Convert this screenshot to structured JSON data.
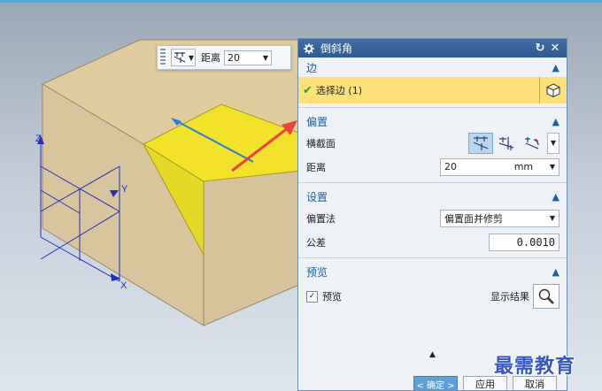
{
  "toolbar": {
    "distance_label": "距离",
    "distance_value": "20"
  },
  "dialog": {
    "title": "倒斜角",
    "edge_section": {
      "title": "边",
      "select_edge_label": "选择边 (1)"
    },
    "offset_section": {
      "title": "偏置",
      "cross_section_label": "横截面",
      "distance_label": "距离",
      "distance_value": "20",
      "distance_unit": "mm"
    },
    "settings_section": {
      "title": "设置",
      "offset_method_label": "偏置法",
      "offset_method_value": "偏置面并修剪",
      "tolerance_label": "公差",
      "tolerance_value": "0.0010"
    },
    "preview_section": {
      "title": "预览",
      "preview_label": "预览",
      "preview_checked": true,
      "show_result_label": "显示结果"
    },
    "buttons": {
      "ok": "< 确定 >",
      "apply": "应用",
      "cancel": "取消"
    }
  },
  "axes": {
    "x": "X",
    "y": "Y",
    "z": "Z"
  },
  "watermark": "最需教育",
  "colors": {
    "dialog_title_bg": "#2d5a8f",
    "section_title": "#1d5fa8",
    "selection_highlight": "#fde07a",
    "solid_face": "#d8c39a",
    "chamfer_face": "#f2e22a",
    "arrow": "#e8463c"
  }
}
